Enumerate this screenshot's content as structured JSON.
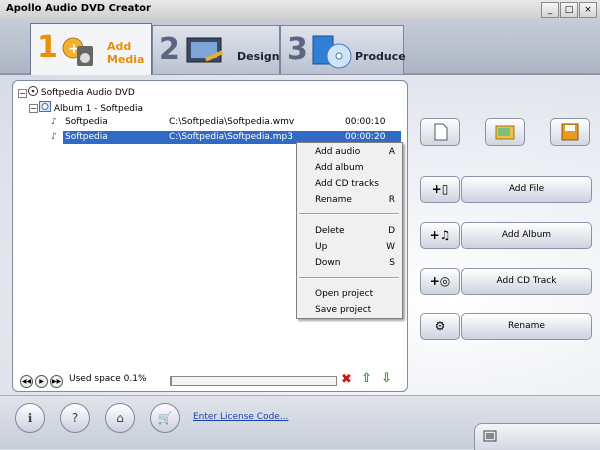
{
  "window": {
    "title": "Apollo Audio DVD Creator",
    "controls": [
      "_",
      "□",
      "×"
    ]
  },
  "tabs": [
    {
      "number": "1",
      "label_line1": "Add",
      "label_line2": "Media",
      "active": true
    },
    {
      "number": "2",
      "label": "Design",
      "active": false
    },
    {
      "number": "3",
      "label": "Produce",
      "active": false
    }
  ],
  "tree": {
    "root": "Softpedia Audio DVD",
    "album": "Album 1 - Softpedia",
    "tracks": [
      {
        "name": "Softpedia",
        "path": "C:\\Softpedia\\Softpedia.wmv",
        "duration": "00:00:10"
      },
      {
        "name": "Softpedia",
        "path": "C:\\Softpedia\\Softpedia.mp3",
        "duration": "00:00:20"
      }
    ]
  },
  "context_menu": {
    "groups": [
      [
        {
          "label": "Add audio",
          "key": "A"
        },
        {
          "label": "Add album",
          "key": ""
        },
        {
          "label": "Add CD tracks",
          "key": ""
        },
        {
          "label": "Rename",
          "key": "R"
        }
      ],
      [
        {
          "label": "Delete",
          "key": "D"
        },
        {
          "label": "Up",
          "key": "W"
        },
        {
          "label": "Down",
          "key": "S"
        }
      ],
      [
        {
          "label": "Open project",
          "key": ""
        },
        {
          "label": "Save project",
          "key": ""
        }
      ]
    ]
  },
  "status": {
    "used_space": "Used space 0.1%",
    "used_fraction": 0.001
  },
  "actions": {
    "add_file": "Add File",
    "add_album": "Add Album",
    "add_cd_track": "Add CD Track",
    "rename": "Rename"
  },
  "footer": {
    "license_link": "Enter License Code..."
  },
  "colors": {
    "accent": "#e8900a",
    "selection": "#316ac5",
    "link": "#1a3fb0"
  }
}
